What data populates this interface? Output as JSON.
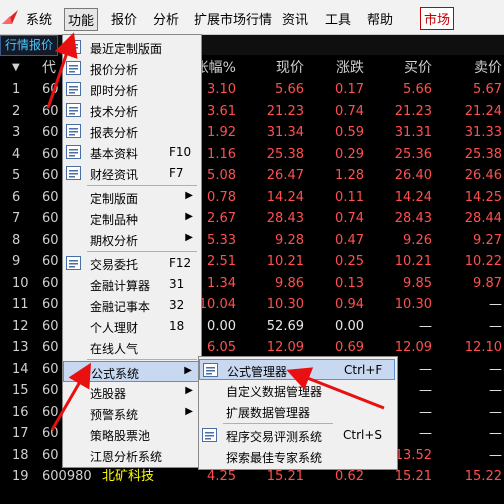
{
  "menubar": {
    "items": [
      "系统",
      "功能",
      "报价",
      "分析",
      "扩展市场行情",
      "资讯",
      "工具",
      "帮助"
    ],
    "market": "市场"
  },
  "tab": "行情报价",
  "headers": {
    "code": "代",
    "pct": "张幅%",
    "price": "现价",
    "chg": "涨跌",
    "bid": "买价",
    "ask": "卖价"
  },
  "rows": [
    {
      "idx": "1",
      "code": "60",
      "pct": "3.10",
      "price": "5.66",
      "chg": "0.17",
      "bid": "5.66",
      "ask": "5.67"
    },
    {
      "idx": "2",
      "code": "60",
      "pct": "3.61",
      "price": "21.23",
      "chg": "0.74",
      "bid": "21.23",
      "ask": "21.24"
    },
    {
      "idx": "3",
      "code": "60",
      "pct": "1.92",
      "price": "31.34",
      "chg": "0.59",
      "bid": "31.31",
      "ask": "31.33"
    },
    {
      "idx": "4",
      "code": "60",
      "pct": "1.16",
      "price": "25.38",
      "chg": "0.29",
      "bid": "25.36",
      "ask": "25.38"
    },
    {
      "idx": "5",
      "code": "60",
      "pct": "5.08",
      "price": "26.47",
      "chg": "1.28",
      "bid": "26.40",
      "ask": "26.46"
    },
    {
      "idx": "6",
      "code": "60",
      "pct": "0.78",
      "price": "14.24",
      "chg": "0.11",
      "bid": "14.24",
      "ask": "14.25"
    },
    {
      "idx": "7",
      "code": "60",
      "pct": "2.67",
      "price": "28.43",
      "chg": "0.74",
      "bid": "28.43",
      "ask": "28.44"
    },
    {
      "idx": "8",
      "code": "60",
      "pct": "5.33",
      "price": "9.28",
      "chg": "0.47",
      "bid": "9.26",
      "ask": "9.27"
    },
    {
      "idx": "9",
      "code": "60",
      "pct": "2.51",
      "price": "10.21",
      "chg": "0.25",
      "bid": "10.21",
      "ask": "10.22"
    },
    {
      "idx": "10",
      "code": "60",
      "pct": "1.34",
      "price": "9.86",
      "chg": "0.13",
      "bid": "9.85",
      "ask": "9.87"
    },
    {
      "idx": "11",
      "code": "60",
      "pct": "10.04",
      "price": "10.30",
      "chg": "0.94",
      "bid": "10.30",
      "ask": "—"
    },
    {
      "idx": "12",
      "code": "60",
      "pct": "0.00",
      "price": "52.69",
      "chg": "0.00",
      "bid": "—",
      "ask": "—"
    },
    {
      "idx": "13",
      "code": "60",
      "pct": "6.05",
      "price": "12.09",
      "chg": "0.69",
      "bid": "12.09",
      "ask": "12.10"
    },
    {
      "idx": "14",
      "code": "60",
      "pct": "",
      "price": "",
      "chg": "",
      "bid": "—",
      "ask": "—"
    },
    {
      "idx": "15",
      "code": "60",
      "pct": "",
      "price": "",
      "chg": "",
      "bid": "—",
      "ask": "—"
    },
    {
      "idx": "16",
      "code": "60",
      "pct": "",
      "price": "",
      "chg": "",
      "bid": "—",
      "ask": "—"
    },
    {
      "idx": "17",
      "code": "60",
      "pct": "",
      "price": "",
      "chg": "",
      "bid": "—",
      "ask": "—"
    },
    {
      "idx": "18",
      "code": "60",
      "pct": "",
      "price": "",
      "chg": "",
      "bid": "13.52",
      "ask": "—"
    },
    {
      "idx": "19",
      "code": "600980",
      "name": "北矿科技",
      "pct": "4.25",
      "price": "15.21",
      "chg": "0.62",
      "bid": "15.21",
      "ask": "15.22"
    }
  ],
  "menu": [
    {
      "label": "最近定制版面",
      "icon": "layout-icon"
    },
    {
      "label": "报价分析",
      "icon": "quote-icon"
    },
    {
      "label": "即时分析",
      "icon": "realtime-icon"
    },
    {
      "label": "技术分析",
      "icon": "tech-icon"
    },
    {
      "label": "报表分析",
      "icon": "report-icon"
    },
    {
      "label": "基本资料",
      "key": "F10",
      "icon": "f10-icon"
    },
    {
      "label": "财经资讯",
      "key": "F7",
      "icon": "news-icon"
    },
    {
      "label": "定制版面",
      "arrow": true
    },
    {
      "label": "定制品种",
      "arrow": true
    },
    {
      "label": "期权分析",
      "arrow": true
    },
    {
      "label": "交易委托",
      "key": "F12",
      "icon": "f12-icon"
    },
    {
      "label": "金融计算器",
      "key": "31"
    },
    {
      "label": "金融记事本",
      "key": "32"
    },
    {
      "label": "个人理财",
      "key": "18"
    },
    {
      "label": "在线人气"
    },
    {
      "label": "公式系统",
      "arrow": true,
      "highlight": true
    },
    {
      "label": "选股器",
      "arrow": true
    },
    {
      "label": "预警系统",
      "arrow": true
    },
    {
      "label": "策略股票池"
    },
    {
      "label": "江恩分析系统"
    }
  ],
  "submenu": [
    {
      "label": "公式管理器",
      "key": "Ctrl+F",
      "icon": "formula-icon",
      "highlight": true
    },
    {
      "label": "自定义数据管理器"
    },
    {
      "label": "扩展数据管理器"
    },
    {
      "label": "程序交易评测系统",
      "key": "Ctrl+S",
      "icon": "program-icon"
    },
    {
      "label": "探索最佳专家系统"
    }
  ]
}
